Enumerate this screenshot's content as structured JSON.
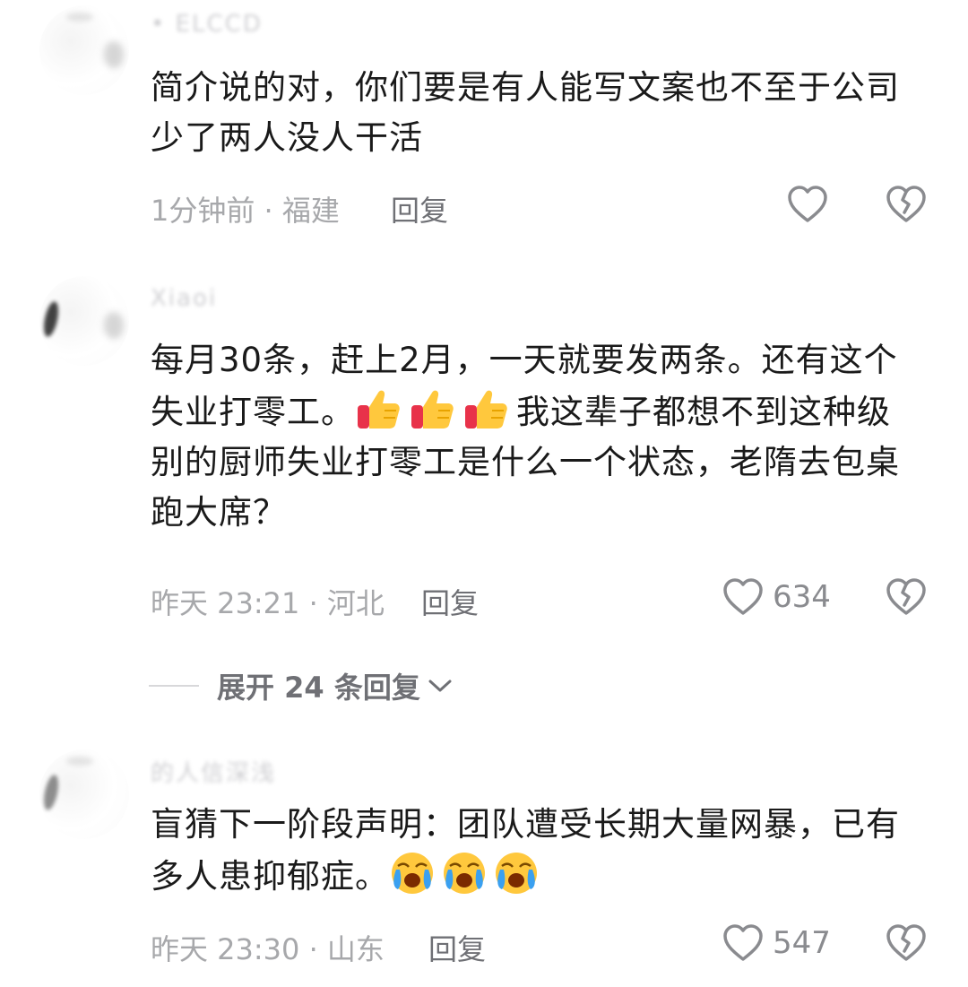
{
  "comments": [
    {
      "username": "• ELCCD",
      "text": "简介说的对，你们要是有人能写文案也不至于公司少了两人没人干活",
      "meta": "1分钟前 · 福建",
      "reply_label": "回复",
      "likes": ""
    },
    {
      "username": "Xiaoi",
      "text_before": "每月30条，赶上2月，一天就要发两条。还有这个失业打零工。",
      "text_after": "我这辈子都想不到这种级别的厨师失业打零工是什么一个状态，老隋去包桌跑大席？",
      "emoji_icon": "thumbs-up-emoji",
      "emoji_count": 3,
      "meta": "昨天 23:21 · 河北",
      "reply_label": "回复",
      "likes": "634",
      "expand_label": "展开 24 条回复"
    },
    {
      "username": "的人信深浅",
      "text_before": "盲猜下一阶段声明：团队遭受长期大量网暴，已有多人患抑郁症。",
      "emoji_icon": "crying-face-emoji",
      "emoji_count": 3,
      "meta": "昨天 23:30 · 山东",
      "reply_label": "回复",
      "likes": "547"
    }
  ],
  "colors": {
    "text": "#1a1a1a",
    "meta": "#a7a8ab",
    "reply": "#6f7075",
    "icon": "#8a8b8f"
  }
}
